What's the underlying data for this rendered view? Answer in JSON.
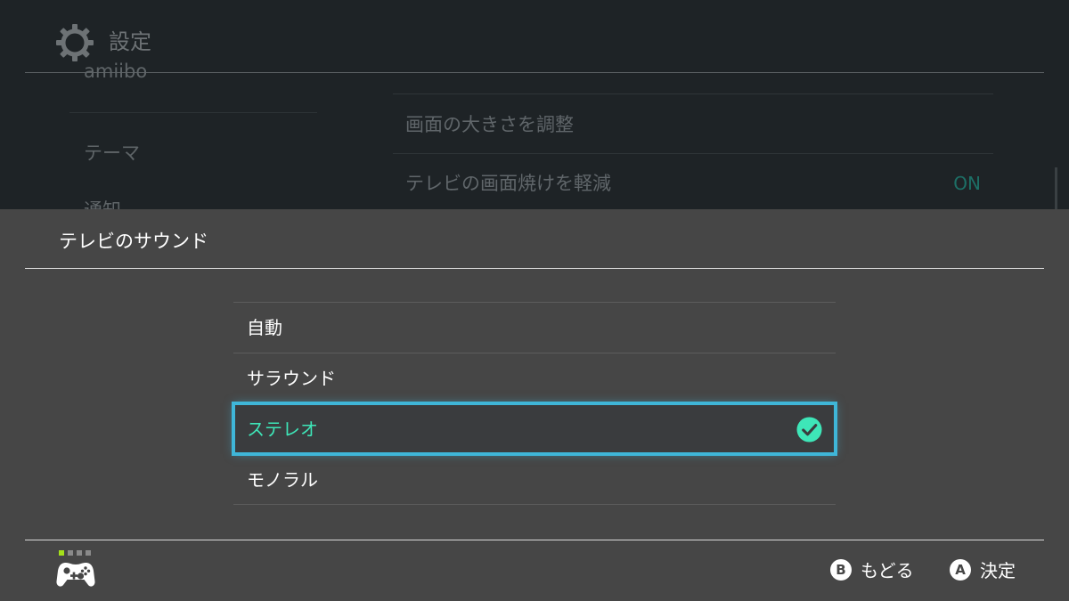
{
  "background": {
    "header_title": "設定",
    "header_icon": "gear-icon",
    "sidebar_items": [
      "amiibo",
      "テーマ",
      "通知"
    ],
    "rows": [
      {
        "label": "画面の大きさを調整",
        "value": ""
      },
      {
        "label": "テレビの画面焼けを軽減",
        "value": "ON"
      }
    ]
  },
  "modal": {
    "title": "テレビのサウンド",
    "options": [
      {
        "label": "自動",
        "selected": false
      },
      {
        "label": "サラウンド",
        "selected": false
      },
      {
        "label": "ステレオ",
        "selected": true
      },
      {
        "label": "モノラル",
        "selected": false
      }
    ],
    "selected_icon": "check-circle-icon"
  },
  "footer": {
    "controller_icon": "controller-icon",
    "player_indicator": {
      "active": 1,
      "total": 4
    },
    "back_button": {
      "key": "B",
      "label": "もどる"
    },
    "ok_button": {
      "key": "A",
      "label": "決定"
    }
  },
  "colors": {
    "background": "#1e2326",
    "sheet": "#464646",
    "accent_selection_border": "#3fb6d8",
    "accent_selected_text": "#3ee6b8",
    "toggle_on": "#1d6f66",
    "player_active": "#a4e01a",
    "player_inactive": "#8a8a8a"
  }
}
